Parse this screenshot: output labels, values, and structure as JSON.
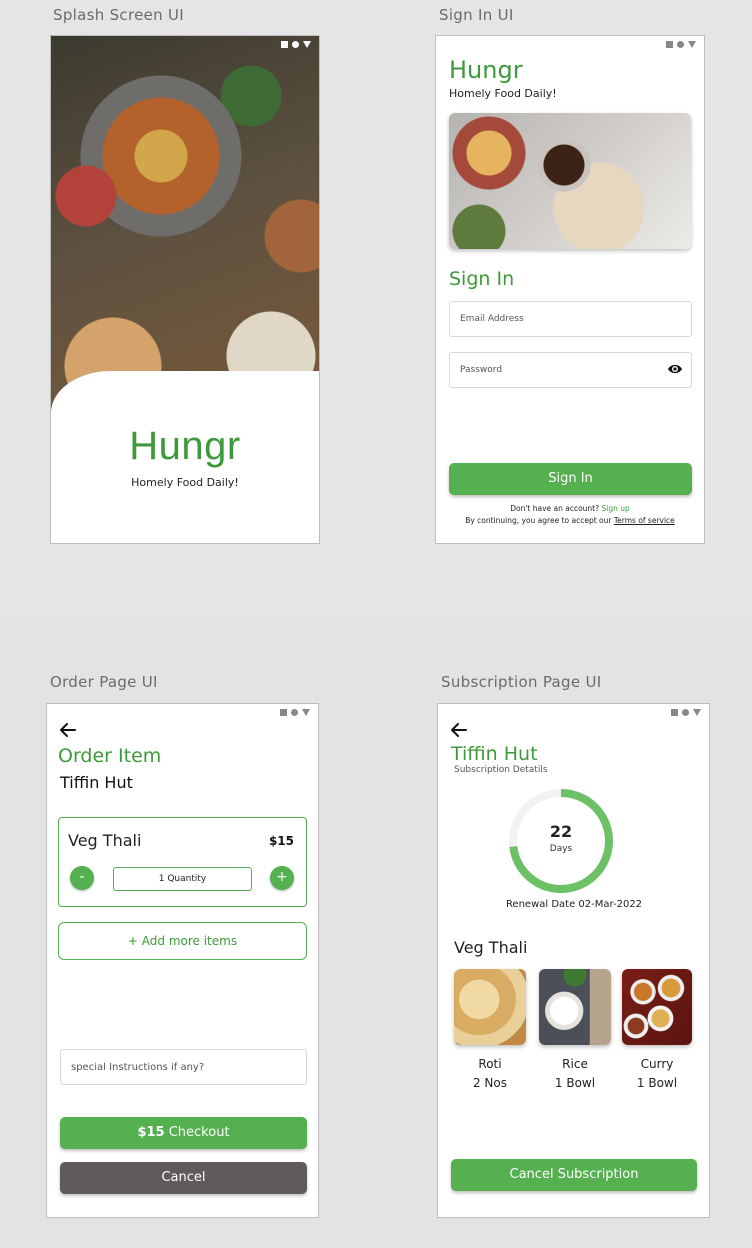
{
  "labels": {
    "splash": "Splash Screen UI",
    "signin": "Sign In UI",
    "order": "Order Page UI",
    "subscription": "Subscription Page UI"
  },
  "brand": {
    "name": "Hungr",
    "tagline": "Homely Food Daily!",
    "accent_color": "#3d9a3a",
    "button_color": "#55b04f"
  },
  "signin": {
    "heading": "Sign In",
    "email_placeholder": "Email Address",
    "password_placeholder": "Password",
    "password_toggle_icon": "eye-icon",
    "button": "Sign In",
    "no_account": "Don't have an account?",
    "signup_link": "Sign up",
    "terms_prefix": "By continuing, you agree to accept our",
    "terms_link": "Terms of service"
  },
  "order": {
    "title": "Order Item",
    "restaurant": "Tiffin Hut",
    "item_name": "Veg Thali",
    "item_price": "$15",
    "minus": "-",
    "plus": "+",
    "quantity": "1 Quantity",
    "add_more": "+ Add more items",
    "instructions_placeholder": "special Instructions if any?",
    "checkout_price": "$15",
    "checkout_label": "Checkout",
    "cancel": "Cancel"
  },
  "subscription": {
    "title": "Tiffin Hut",
    "subtitle": "Subscription Detatils",
    "days_value": "22",
    "days_label": "Days",
    "progress_fraction": 0.73,
    "renewal": "Renewal Date 02-Mar-2022",
    "meal": "Veg Thali",
    "dishes": [
      {
        "name": "Roti",
        "qty": "2 Nos"
      },
      {
        "name": "Rice",
        "qty": "1 Bowl"
      },
      {
        "name": "Curry",
        "qty": "1 Bowl"
      }
    ],
    "cancel": "Cancel Subscription"
  }
}
